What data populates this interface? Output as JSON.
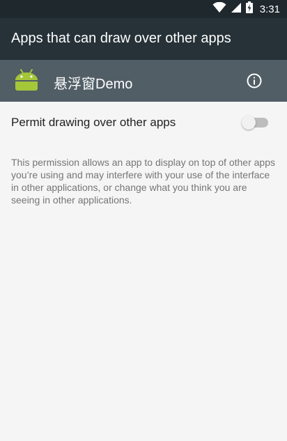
{
  "status_bar": {
    "time": "3:31",
    "icons": [
      "wifi-icon",
      "signal-icon",
      "battery-charging-icon"
    ]
  },
  "toolbar": {
    "title": "Apps that can draw over other apps"
  },
  "app": {
    "name": "悬浮窗Demo",
    "icon": "android-icon",
    "info_icon": "info-icon"
  },
  "permission": {
    "label": "Permit drawing over other apps",
    "enabled": false,
    "description": "This permission allows an app to display on top of other apps you’re using and may interfere with your use of the interface in other applications, or change what you think you are seeing in other applications."
  },
  "colors": {
    "status_bar": "#1f282d",
    "toolbar": "#263238",
    "app_header": "#515e66",
    "background": "#f5f5f5",
    "android_green": "#a4c639"
  }
}
